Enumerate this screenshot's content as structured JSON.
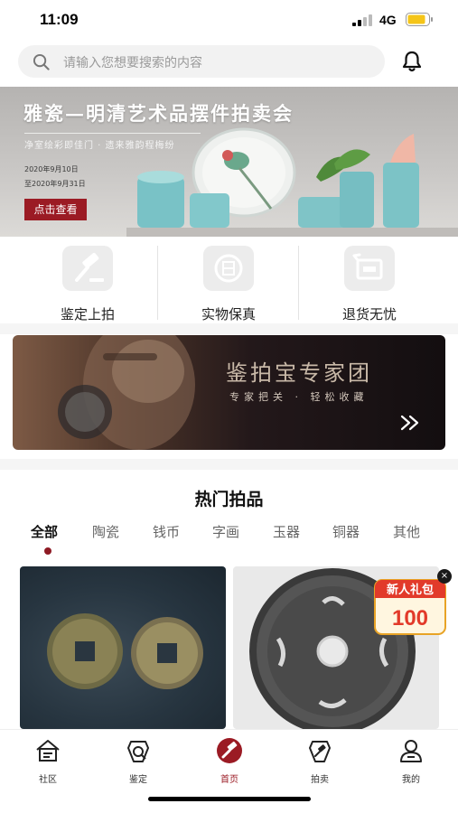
{
  "status_bar": {
    "time": "11:09",
    "network": "4G",
    "battery_color": "#f5c518"
  },
  "search": {
    "placeholder": "请输入您想要搜索的内容"
  },
  "banner": {
    "title": "雅瓷—明清艺术品摆件拍卖会",
    "subtitle": "净室绘彩即佳门 · 遗来雅韵程梅纷",
    "date_start": "2020年9月10日",
    "date_end": "至2020年9月31日",
    "cta": "点击查看"
  },
  "features": [
    {
      "label": "鉴定上拍",
      "icon": "gavel-icon"
    },
    {
      "label": "实物保真",
      "icon": "authentic-badge-icon"
    },
    {
      "label": "退货无忧",
      "icon": "return-icon"
    }
  ],
  "expert_banner": {
    "title": "鉴拍宝专家团",
    "slogan": "专家把关 · 轻松收藏"
  },
  "hot": {
    "title": "热门拍品",
    "tabs": [
      "全部",
      "陶瓷",
      "钱币",
      "字画",
      "玉器",
      "铜器",
      "其他"
    ],
    "active_tab": "全部"
  },
  "promo": {
    "title": "新人礼包",
    "amount": "100",
    "close": "×"
  },
  "tabbar": [
    {
      "label": "社区",
      "icon": "community-icon"
    },
    {
      "label": "鉴定",
      "icon": "appraise-icon"
    },
    {
      "label": "首页",
      "icon": "home-gavel-icon",
      "active": true
    },
    {
      "label": "拍卖",
      "icon": "auction-icon"
    },
    {
      "label": "我的",
      "icon": "profile-icon"
    }
  ],
  "colors": {
    "accent": "#9b1b24",
    "tab_dot": "#8e1a24"
  }
}
